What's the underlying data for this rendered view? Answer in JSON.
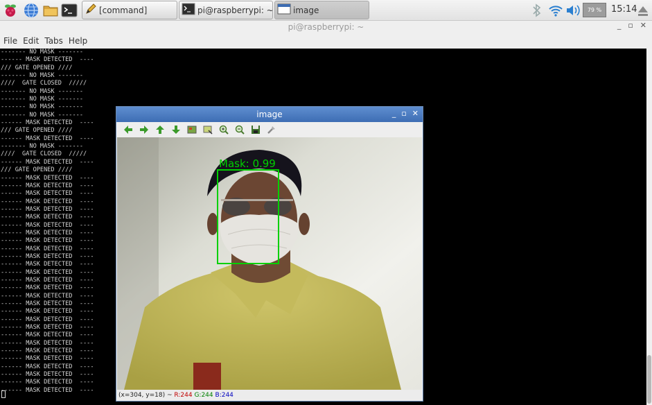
{
  "taskbar": {
    "launchers": [
      "raspberry-menu-icon",
      "web-browser-icon",
      "file-manager-icon",
      "terminal-icon"
    ],
    "tasks": [
      {
        "label": "[command]",
        "icon": "text-editor-icon"
      },
      {
        "label": "pi@raspberrypi: ~",
        "icon": "terminal-icon"
      },
      {
        "label": "image",
        "icon": "window-icon"
      }
    ],
    "cpu_label": "79 %",
    "clock": "15:14"
  },
  "terminal": {
    "title": "pi@raspberrypi: ~",
    "menu": [
      "File",
      "Edit",
      "Tabs",
      "Help"
    ],
    "lines": [
      "------- NO MASK -------",
      "------ MASK DETECTED  ----",
      "/// GATE OPENED ////",
      "------- NO MASK -------",
      "////  GATE CLOSED  /////",
      "------- NO MASK -------",
      "------- NO MASK -------",
      "------- NO MASK -------",
      "------- NO MASK -------",
      "------ MASK DETECTED  ----",
      "/// GATE OPENED ////",
      "------ MASK DETECTED  ----",
      "------- NO MASK -------",
      "////  GATE CLOSED  /////",
      "------ MASK DETECTED  ----",
      "/// GATE OPENED ////",
      "------ MASK DETECTED  ----",
      "------ MASK DETECTED  ----",
      "------ MASK DETECTED  ----",
      "------ MASK DETECTED  ----",
      "------ MASK DETECTED  ----",
      "------ MASK DETECTED  ----",
      "------ MASK DETECTED  ----",
      "------ MASK DETECTED  ----",
      "------ MASK DETECTED  ----",
      "------ MASK DETECTED  ----",
      "------ MASK DETECTED  ----",
      "------ MASK DETECTED  ----",
      "------ MASK DETECTED  ----",
      "------ MASK DETECTED  ----",
      "------ MASK DETECTED  ----",
      "------ MASK DETECTED  ----",
      "------ MASK DETECTED  ----",
      "------ MASK DETECTED  ----",
      "------ MASK DETECTED  ----",
      "------ MASK DETECTED  ----",
      "------ MASK DETECTED  ----",
      "------ MASK DETECTED  ----",
      "------ MASK DETECTED  ----",
      "------ MASK DETECTED  ----",
      "------ MASK DETECTED  ----",
      "------ MASK DETECTED  ----",
      "------ MASK DETECTED  ----",
      "------ MASK DETECTED  ----"
    ]
  },
  "image_window": {
    "title": "image",
    "toolbar_icons": [
      "pan-left-icon",
      "pan-right-icon",
      "pan-up-icon",
      "pan-down-icon",
      "zoom-fit-icon",
      "zoom-region-icon",
      "zoom-in-icon",
      "zoom-out-icon",
      "save-icon",
      "properties-icon"
    ],
    "detection_label": "Mask: 0.99",
    "detection_color": "#00d000",
    "status": {
      "coords": "(x=304, y=18) ~",
      "r": "R:244",
      "g": "G:244",
      "b": "B:244"
    }
  }
}
